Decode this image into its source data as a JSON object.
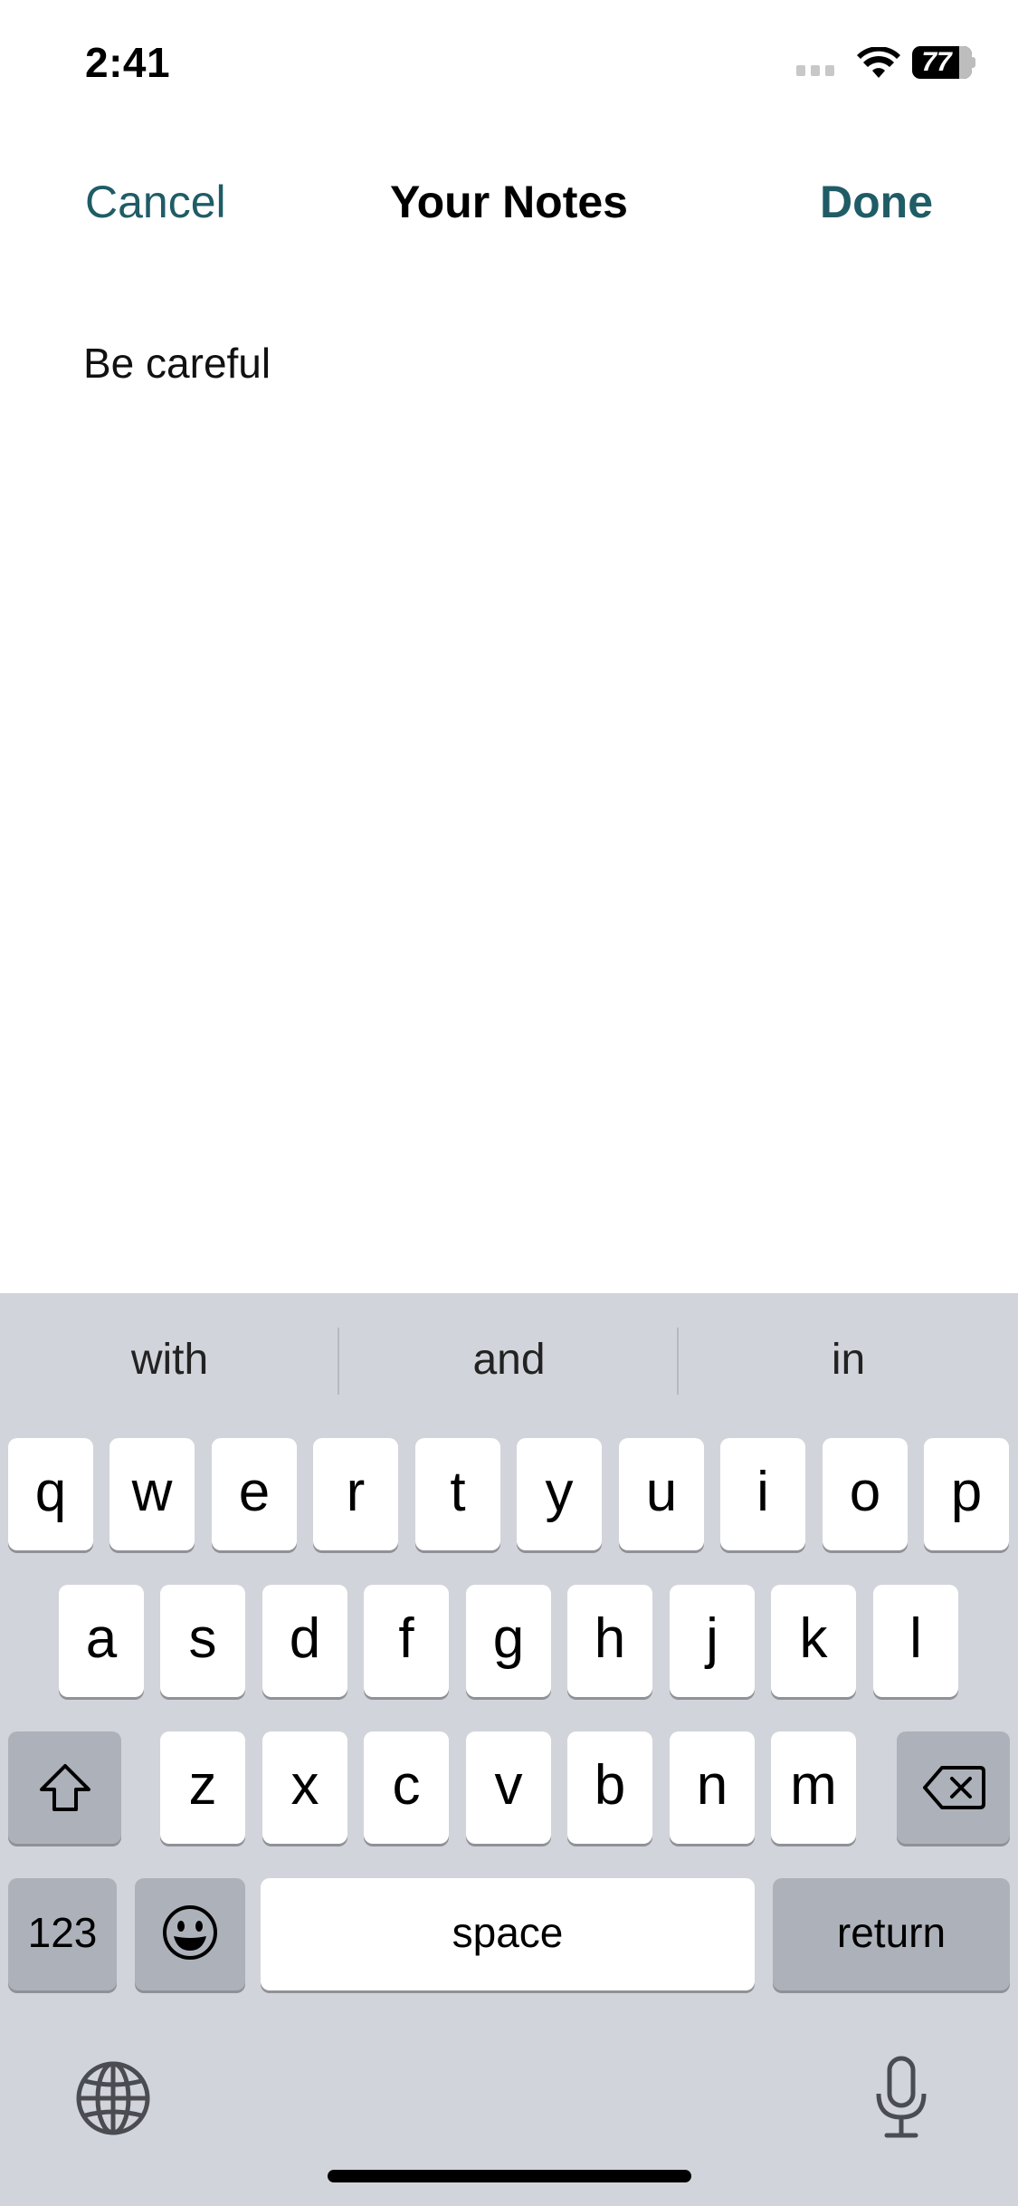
{
  "status_bar": {
    "time": "2:41",
    "battery": "77"
  },
  "nav": {
    "cancel_label": "Cancel",
    "title": "Your Notes",
    "done_label": "Done",
    "accent_color": "#1f5c66"
  },
  "note": {
    "text": "Be careful"
  },
  "keyboard": {
    "suggestions": [
      "with",
      "and",
      "in"
    ],
    "row1": [
      "q",
      "w",
      "e",
      "r",
      "t",
      "y",
      "u",
      "i",
      "o",
      "p"
    ],
    "row2": [
      "a",
      "s",
      "d",
      "f",
      "g",
      "h",
      "j",
      "k",
      "l"
    ],
    "row3": [
      "z",
      "x",
      "c",
      "v",
      "b",
      "n",
      "m"
    ],
    "numbers_label": "123",
    "space_label": "space",
    "return_label": "return",
    "icons": [
      "shift-icon",
      "backspace-icon",
      "emoji-icon",
      "globe-icon",
      "microphone-icon"
    ]
  }
}
